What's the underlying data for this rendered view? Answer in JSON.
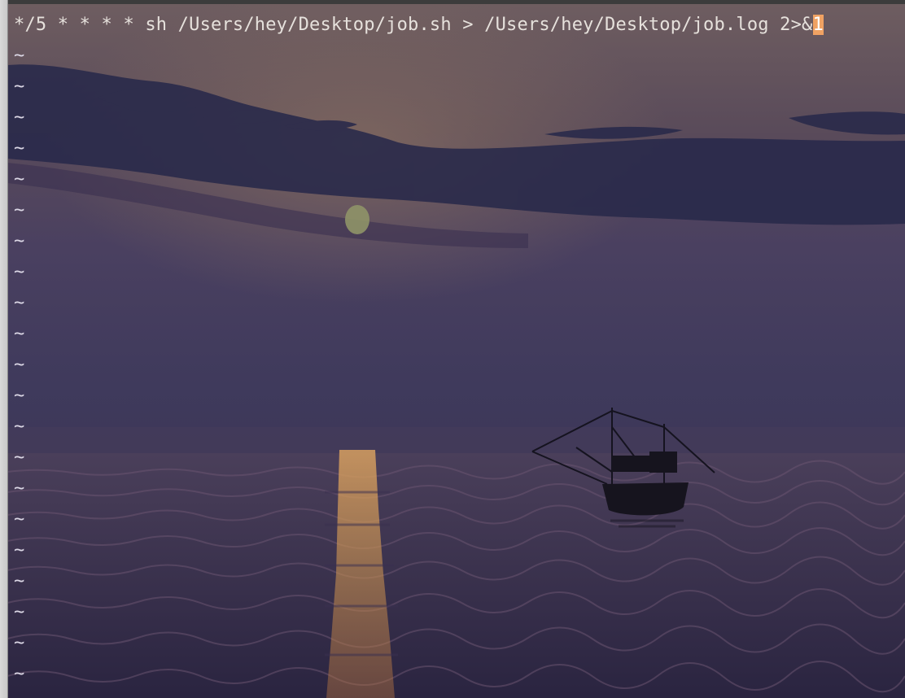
{
  "editor": {
    "command_text": "*/5 * * * * sh /Users/hey/Desktop/job.sh > /Users/hey/Desktop/job.log 2>&",
    "cursor_char": "1",
    "empty_line_marker": "~",
    "empty_line_count": 21
  },
  "colors": {
    "text": "#e6e1dc",
    "cursor": "#f0a263",
    "sky": "#4a3d52",
    "water": "#2c2640"
  },
  "background": {
    "scene": "sunset-sea-with-boat",
    "icon": "boat-silhouette-icon"
  }
}
